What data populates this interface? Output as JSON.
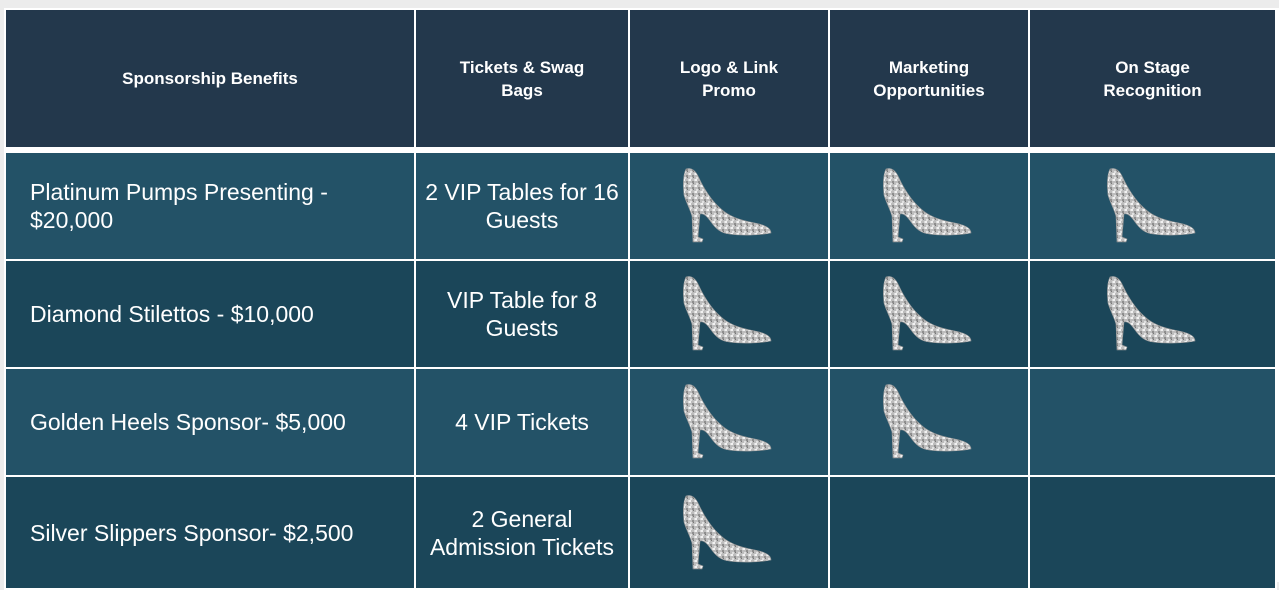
{
  "table": {
    "headers": [
      "Sponsorship Benefits",
      "Tickets & Swag Bags",
      "Logo & Link Promo",
      "Marketing Opportunities",
      "On  Stage Recognition"
    ],
    "rows": [
      {
        "name": "Platinum Pumps Presenting - $20,000",
        "tickets": "2 VIP Tables for 16 Guests",
        "logo_link_promo": true,
        "marketing": true,
        "on_stage": true
      },
      {
        "name": "Diamond Stilettos - $10,000",
        "tickets": "VIP Table for 8 Guests",
        "logo_link_promo": true,
        "marketing": true,
        "on_stage": true
      },
      {
        "name": "Golden Heels Sponsor- $5,000",
        "tickets": "4 VIP Tickets",
        "logo_link_promo": true,
        "marketing": true,
        "on_stage": false
      },
      {
        "name": "Silver Slippers Sponsor- $2,500",
        "tickets": "2 General Admission Tickets",
        "logo_link_promo": true,
        "marketing": false,
        "on_stage": false
      }
    ],
    "icon": "silver-glitter-high-heel-icon",
    "colors": {
      "header_bg": "#23384c",
      "row_light": "#235267",
      "row_dark": "#1b4659",
      "border": "#ffffff",
      "text": "#ffffff",
      "shoe": "#c4c4c4"
    }
  }
}
